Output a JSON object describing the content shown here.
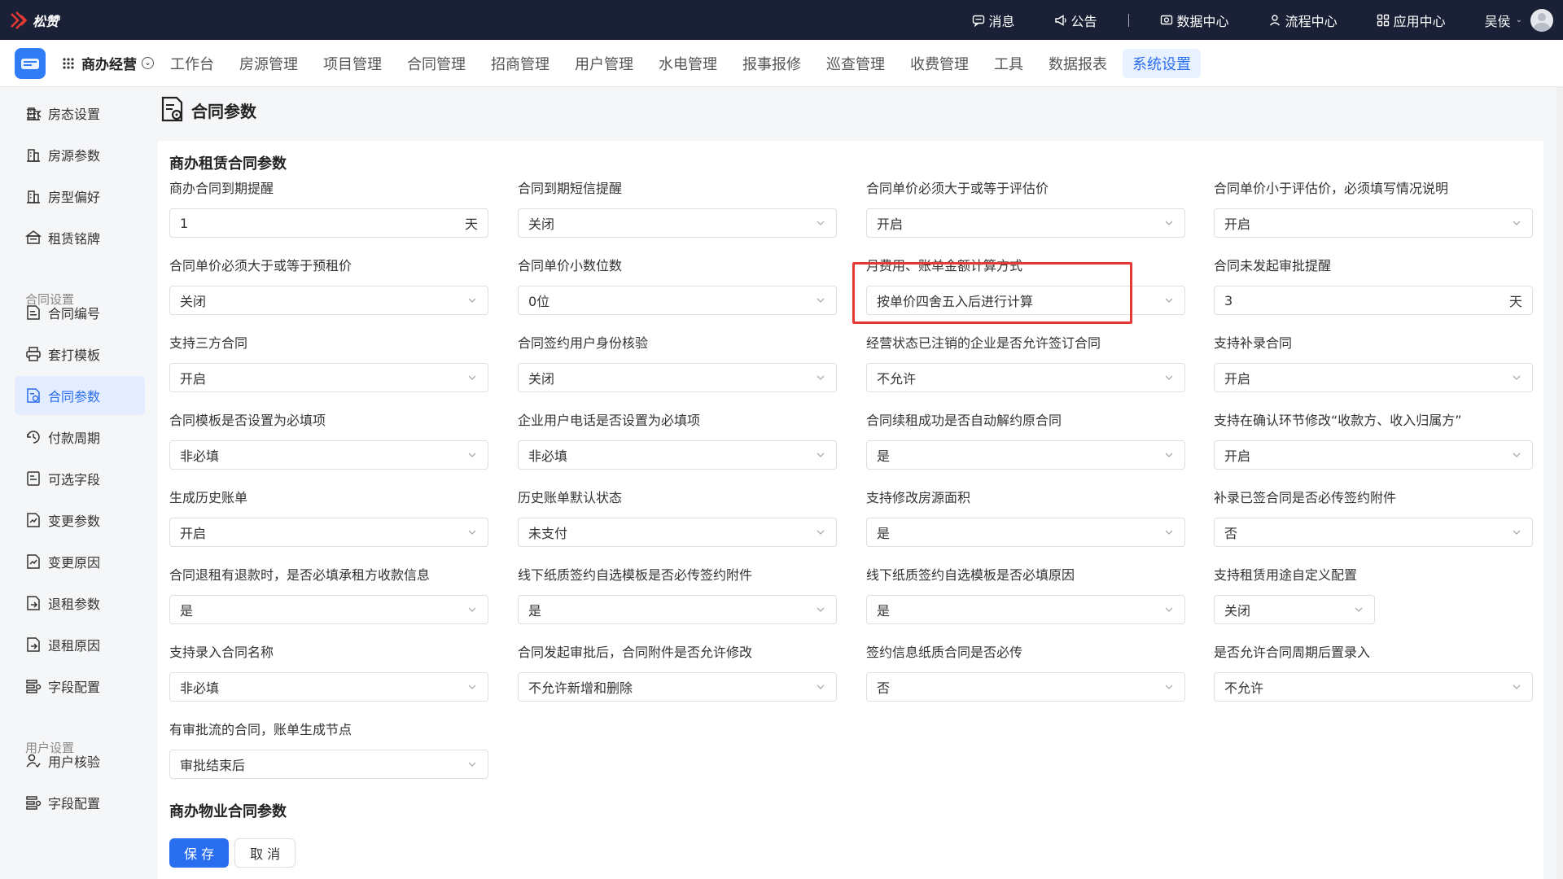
{
  "topbar": {
    "brand": "松赞",
    "items": [
      {
        "label": "消息",
        "icon": "message-icon"
      },
      {
        "label": "公告",
        "icon": "megaphone-icon"
      },
      {
        "label": "数据中心",
        "icon": "database-icon"
      },
      {
        "label": "流程中心",
        "icon": "flow-icon"
      },
      {
        "label": "应用中心",
        "icon": "apps-icon"
      }
    ],
    "user": "吴侯"
  },
  "navbar": {
    "app_name": "商办经营",
    "tabs": [
      "工作台",
      "房源管理",
      "项目管理",
      "合同管理",
      "招商管理",
      "用户管理",
      "水电管理",
      "报事报修",
      "巡查管理",
      "收费管理",
      "工具",
      "数据报表",
      "系统设置"
    ],
    "active_tab": "系统设置"
  },
  "sidebar": {
    "items": [
      {
        "label": "房态设置",
        "icon": "building-icon"
      },
      {
        "label": "房源参数",
        "icon": "building-icon"
      },
      {
        "label": "房型偏好",
        "icon": "building-icon"
      },
      {
        "label": "租赁铭牌",
        "icon": "nameplate-icon"
      },
      {
        "group": "合同设置"
      },
      {
        "label": "合同编号",
        "icon": "document-icon"
      },
      {
        "label": "套打模板",
        "icon": "printer-icon"
      },
      {
        "label": "合同参数",
        "icon": "document-settings-icon",
        "active": true
      },
      {
        "label": "付款周期",
        "icon": "cycle-icon"
      },
      {
        "label": "可选字段",
        "icon": "field-icon"
      },
      {
        "label": "变更参数",
        "icon": "change-icon"
      },
      {
        "label": "变更原因",
        "icon": "change-icon"
      },
      {
        "label": "退租参数",
        "icon": "exit-icon"
      },
      {
        "label": "退租原因",
        "icon": "exit-icon"
      },
      {
        "label": "字段配置",
        "icon": "config-icon"
      },
      {
        "group": "用户设置"
      },
      {
        "label": "用户核验",
        "icon": "user-check-icon"
      },
      {
        "label": "字段配置",
        "icon": "config-icon"
      }
    ]
  },
  "page": {
    "title": "合同参数",
    "section1_title": "商办租赁合同参数",
    "section2_title": "商办物业合同参数",
    "fields": [
      {
        "label": "商办合同到期提醒",
        "value": "1",
        "suffix": "天",
        "type": "input"
      },
      {
        "label": "合同到期短信提醒",
        "value": "关闭",
        "type": "select"
      },
      {
        "label": "合同单价必须大于或等于评估价",
        "value": "开启",
        "type": "select"
      },
      {
        "label": "合同单价小于评估价，必须填写情况说明",
        "value": "开启",
        "type": "select"
      },
      {
        "label": "合同单价必须大于或等于预租价",
        "value": "关闭",
        "type": "select"
      },
      {
        "label": "合同单价小数位数",
        "value": "0位",
        "type": "select"
      },
      {
        "label": "月费用、账单金额计算方式",
        "value": "按单价四舍五入后进行计算",
        "type": "select"
      },
      {
        "label": "合同未发起审批提醒",
        "value": "3",
        "suffix": "天",
        "type": "input"
      },
      {
        "label": "支持三方合同",
        "value": "开启",
        "type": "select"
      },
      {
        "label": "合同签约用户身份核验",
        "value": "关闭",
        "type": "select"
      },
      {
        "label": "经营状态已注销的企业是否允许签订合同",
        "value": "不允许",
        "type": "select",
        "highlighted": true
      },
      {
        "label": "支持补录合同",
        "value": "开启",
        "type": "select"
      },
      {
        "label": "合同模板是否设置为必填项",
        "value": "非必填",
        "type": "select"
      },
      {
        "label": "企业用户电话是否设置为必填项",
        "value": "非必填",
        "type": "select"
      },
      {
        "label": "合同续租成功是否自动解约原合同",
        "value": "是",
        "type": "select"
      },
      {
        "label": "支持在确认环节修改“收款方、收入归属方”",
        "value": "开启",
        "type": "select"
      },
      {
        "label": "生成历史账单",
        "value": "开启",
        "type": "select"
      },
      {
        "label": "历史账单默认状态",
        "value": "未支付",
        "type": "select"
      },
      {
        "label": "支持修改房源面积",
        "value": "是",
        "type": "select"
      },
      {
        "label": "补录已签合同是否必传签约附件",
        "value": "否",
        "type": "select"
      },
      {
        "label": "合同退租有退款时，是否必填承租方收款信息",
        "value": "是",
        "type": "select"
      },
      {
        "label": "线下纸质签约自选模板是否必传签约附件",
        "value": "是",
        "type": "select"
      },
      {
        "label": "线下纸质签约自选模板是否必填原因",
        "value": "是",
        "type": "select"
      },
      {
        "label": "支持租赁用途自定义配置",
        "value": "关闭",
        "type": "select",
        "short": true
      },
      {
        "label": "支持录入合同名称",
        "value": "非必填",
        "type": "select"
      },
      {
        "label": "合同发起审批后，合同附件是否允许修改",
        "value": "不允许新增和删除",
        "type": "select"
      },
      {
        "label": "签约信息纸质合同是否必传",
        "value": "否",
        "type": "select"
      },
      {
        "label": "是否允许合同周期后置录入",
        "value": "不允许",
        "type": "select"
      },
      {
        "label": "有审批流的合同，账单生成节点",
        "value": "审批结束后",
        "type": "select"
      }
    ],
    "save_label": "保 存",
    "cancel_label": "取 消"
  },
  "colors": {
    "topbar": "#1a2035",
    "accent": "#2a6ef0",
    "highlight": "#e53935"
  }
}
